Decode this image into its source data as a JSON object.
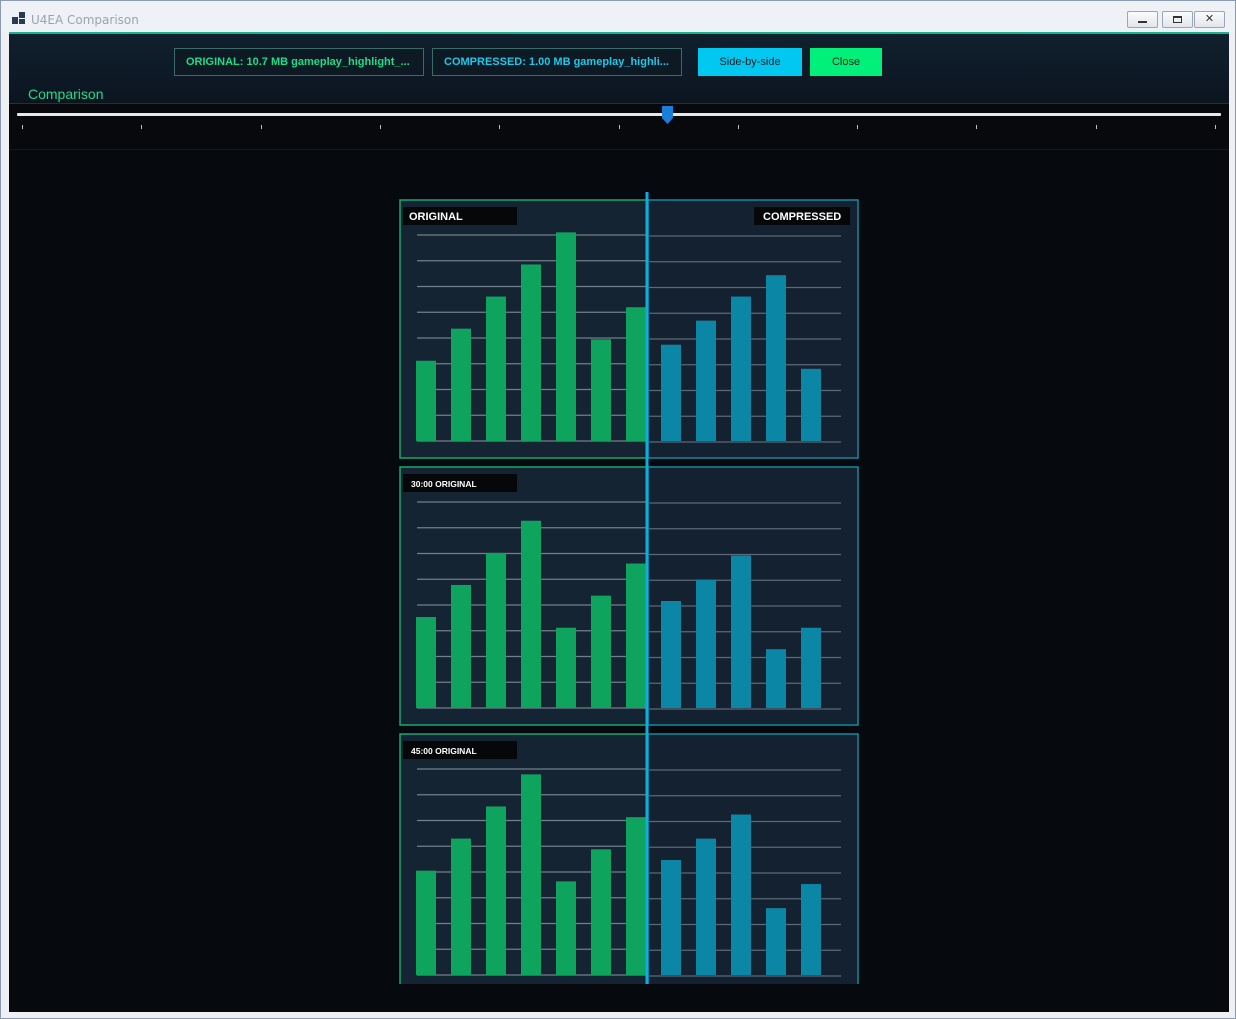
{
  "window": {
    "title": "U4EA Comparison"
  },
  "header": {
    "original_info": "ORIGINAL: 10.7 MB  gameplay_highlight_...",
    "compressed_info": "COMPRESSED: 1.00 MB  gameplay_highli...",
    "side_by_side_label": "Side-by-side",
    "close_label": "Close",
    "comparison_label": "Comparison"
  },
  "slider": {
    "position_fraction": 0.54,
    "tick_count": 11
  },
  "colors": {
    "original": "#0fa45e",
    "compressed": "#0b86a4",
    "divider": "#0aaee0",
    "accent_green": "#1edc8a",
    "accent_cyan": "#00c8f0"
  },
  "chart_data": [
    {
      "type": "bar",
      "panel_label": "ORIGINAL",
      "right_label": "COMPRESSED",
      "series": [
        {
          "name": "ORIGINAL",
          "values": [
            30,
            42,
            54,
            66,
            78,
            38,
            50
          ]
        },
        {
          "name": "COMPRESSED",
          "values": [
            36,
            45,
            54,
            62,
            27
          ]
        }
      ],
      "ylim": [
        0,
        80
      ]
    },
    {
      "type": "bar",
      "panel_label": "30:00  ORIGINAL",
      "right_label": "",
      "series": [
        {
          "name": "ORIGINAL",
          "values": [
            34,
            46,
            58,
            70,
            30,
            42,
            54
          ]
        },
        {
          "name": "COMPRESSED",
          "values": [
            40,
            48,
            57,
            22,
            30
          ]
        }
      ],
      "ylim": [
        0,
        80
      ]
    },
    {
      "type": "bar",
      "panel_label": "45:00  ORIGINAL",
      "right_label": "",
      "series": [
        {
          "name": "ORIGINAL",
          "values": [
            39,
            51,
            63,
            75,
            35,
            47,
            59
          ]
        },
        {
          "name": "COMPRESSED",
          "values": [
            43,
            51,
            60,
            25,
            34
          ]
        }
      ],
      "ylim": [
        0,
        80
      ]
    }
  ]
}
